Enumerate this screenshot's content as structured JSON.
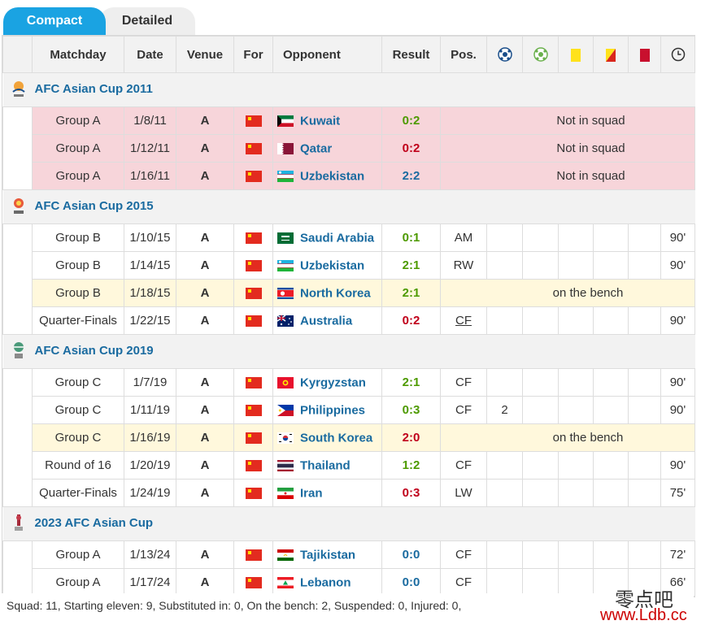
{
  "tabs": {
    "compact": "Compact",
    "detailed": "Detailed"
  },
  "headers": {
    "matchday": "Matchday",
    "date": "Date",
    "venue": "Venue",
    "for": "For",
    "opponent": "Opponent",
    "result": "Result",
    "pos": "Pos."
  },
  "icons": [
    "goal-ball-icon",
    "assist-ball-icon",
    "yellow-card-icon",
    "yellow-red-card-icon",
    "red-card-icon",
    "clock-icon"
  ],
  "competitions": [
    {
      "name": "AFC Asian Cup 2011",
      "matches": [
        {
          "matchday": "Group A",
          "date": "1/8/11",
          "venue": "A",
          "opponent": "Kuwait",
          "flag": "kuwait",
          "result": "0:2",
          "res": "w",
          "status": "notsquad",
          "note": "Not in squad"
        },
        {
          "matchday": "Group A",
          "date": "1/12/11",
          "venue": "A",
          "opponent": "Qatar",
          "flag": "qatar",
          "result": "0:2",
          "res": "l",
          "status": "notsquad",
          "note": "Not in squad"
        },
        {
          "matchday": "Group A",
          "date": "1/16/11",
          "venue": "A",
          "opponent": "Uzbekistan",
          "flag": "uzbekistan",
          "result": "2:2",
          "res": "d",
          "status": "notsquad",
          "note": "Not in squad"
        }
      ]
    },
    {
      "name": "AFC Asian Cup 2015",
      "matches": [
        {
          "matchday": "Group B",
          "date": "1/10/15",
          "venue": "A",
          "opponent": "Saudi Arabia",
          "flag": "saudi",
          "result": "0:1",
          "res": "w",
          "status": "played",
          "pos": "AM",
          "goals": "",
          "minutes": "90'"
        },
        {
          "matchday": "Group B",
          "date": "1/14/15",
          "venue": "A",
          "opponent": "Uzbekistan",
          "flag": "uzbekistan",
          "result": "2:1",
          "res": "w",
          "status": "played",
          "pos": "RW",
          "goals": "",
          "minutes": "90'"
        },
        {
          "matchday": "Group B",
          "date": "1/18/15",
          "venue": "A",
          "opponent": "North Korea",
          "flag": "nkorea",
          "result": "2:1",
          "res": "w",
          "status": "bench",
          "note": "on the bench"
        },
        {
          "matchday": "Quarter-Finals",
          "date": "1/22/15",
          "venue": "A",
          "opponent": "Australia",
          "flag": "australia",
          "result": "0:2",
          "res": "l",
          "status": "played",
          "pos": "CF",
          "poslink": true,
          "goals": "",
          "minutes": "90'"
        }
      ]
    },
    {
      "name": "AFC Asian Cup 2019",
      "matches": [
        {
          "matchday": "Group C",
          "date": "1/7/19",
          "venue": "A",
          "opponent": "Kyrgyzstan",
          "flag": "kyrgyz",
          "result": "2:1",
          "res": "w",
          "status": "played",
          "pos": "CF",
          "goals": "",
          "minutes": "90'"
        },
        {
          "matchday": "Group C",
          "date": "1/11/19",
          "venue": "A",
          "opponent": "Philippines",
          "flag": "philippines",
          "result": "0:3",
          "res": "w",
          "status": "played",
          "pos": "CF",
          "goals": "2",
          "minutes": "90'"
        },
        {
          "matchday": "Group C",
          "date": "1/16/19",
          "venue": "A",
          "opponent": "South Korea",
          "flag": "skorea",
          "result": "2:0",
          "res": "l",
          "status": "bench",
          "note": "on the bench"
        },
        {
          "matchday": "Round of 16",
          "date": "1/20/19",
          "venue": "A",
          "opponent": "Thailand",
          "flag": "thailand",
          "result": "1:2",
          "res": "w",
          "status": "played",
          "pos": "CF",
          "goals": "",
          "minutes": "90'"
        },
        {
          "matchday": "Quarter-Finals",
          "date": "1/24/19",
          "venue": "A",
          "opponent": "Iran",
          "flag": "iran",
          "result": "0:3",
          "res": "l",
          "status": "played",
          "pos": "LW",
          "goals": "",
          "minutes": "75'"
        }
      ]
    },
    {
      "name": "2023 AFC Asian Cup",
      "matches": [
        {
          "matchday": "Group A",
          "date": "1/13/24",
          "venue": "A",
          "opponent": "Tajikistan",
          "flag": "tajik",
          "result": "0:0",
          "res": "d",
          "status": "played",
          "pos": "CF",
          "goals": "",
          "minutes": "72'"
        },
        {
          "matchday": "Group A",
          "date": "1/17/24",
          "venue": "A",
          "opponent": "Lebanon",
          "flag": "lebanon",
          "result": "0:0",
          "res": "d",
          "status": "played",
          "pos": "CF",
          "goals": "",
          "minutes": "66'"
        }
      ]
    }
  ],
  "footer": "Squad: 11, Starting eleven: 9, Substituted in: 0, On the bench: 2, Suspended: 0, Injured: 0,",
  "watermark": {
    "line1": "零点吧",
    "line2": "www.Ldb.cc"
  },
  "colors": {
    "tab_active": "#1aa3e2",
    "link": "#1a6ba0",
    "win": "#4d9a00",
    "loss": "#c0001a",
    "not_in_squad_bg": "#f7d5da",
    "bench_bg": "#fff8dc"
  }
}
